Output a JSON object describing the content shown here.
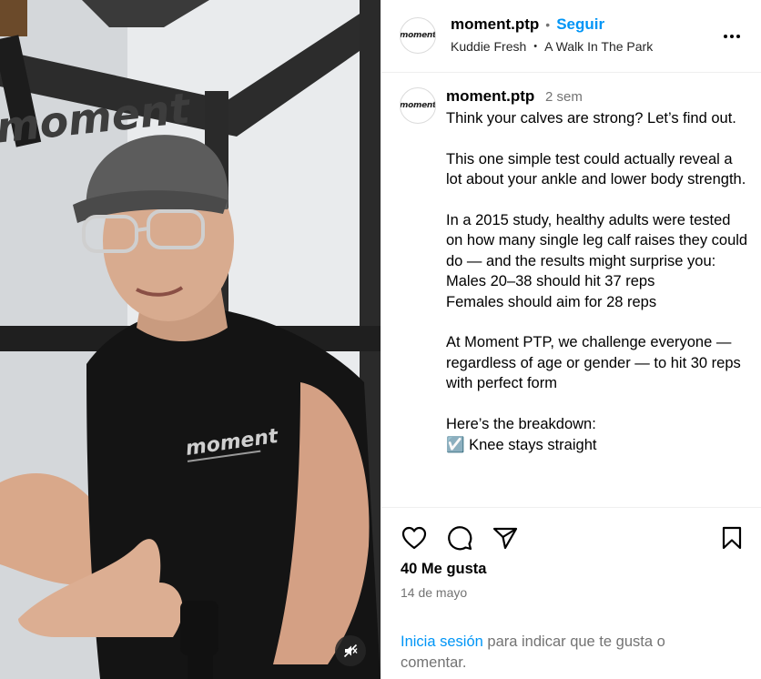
{
  "video": {
    "wall_brand": "moment",
    "shirt_brand": "moment",
    "mute_icon": "speaker-muted-icon"
  },
  "header": {
    "username": "moment.ptp",
    "separator": "•",
    "follow_label": "Seguir",
    "audio_artist": "Kuddie Fresh",
    "audio_separator": "•",
    "audio_title": "A Walk In The Park",
    "avatar_text": "moment",
    "more_icon": "ellipsis-icon"
  },
  "caption": {
    "username": "moment.ptp",
    "time": "2 sem",
    "avatar_text": "moment",
    "text": "Think your calves are strong? Let’s find out.\n\nThis one simple test could actually reveal a lot about your ankle and lower body strength.\n\nIn a 2015 study, healthy adults were tested on how many single leg calf raises they could do — and the results might surprise you:\nMales 20–38 should hit 37 reps\nFemales should aim for 28 reps\n\nAt Moment PTP, we challenge everyone — regardless of age or gender — to hit 30 reps with perfect form\n\nHere’s the breakdown:\n☑️ Knee stays straight"
  },
  "actions": {
    "like_icon": "heart-icon",
    "comment_icon": "comment-icon",
    "share_icon": "share-icon",
    "save_icon": "bookmark-icon",
    "likes": "40 Me gusta",
    "date": "14 de mayo",
    "login_link": "Inicia sesión",
    "login_rest": " para indicar que te gusta o comentar."
  },
  "colors": {
    "accent": "#0095f6",
    "muted_text": "#737373",
    "divider": "#efefef"
  }
}
